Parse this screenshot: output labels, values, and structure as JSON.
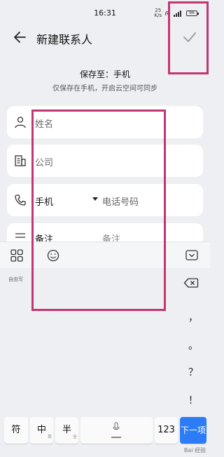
{
  "status": {
    "time": "16:31",
    "net_speed_value": "25",
    "net_speed_unit": "K/s",
    "battery": "96"
  },
  "header": {
    "title": "新建联系人"
  },
  "save_location": {
    "label": "保存至：手机",
    "hint": "仅保存在手机，开启云空间可同步"
  },
  "form": {
    "name_placeholder": "姓名",
    "company_placeholder": "公司",
    "phone_type": "手机",
    "phone_placeholder": "电话号码",
    "notes_label": "备注",
    "notes_placeholder": "备注"
  },
  "keyboard": {
    "freewrite_label": "自由写",
    "punctuation": [
      "，",
      "。",
      "？",
      "！"
    ],
    "keys": {
      "symbol": "符",
      "chinese": "中",
      "chinese_sub": "英",
      "halfwidth": "半",
      "halfwidth_sub": "全",
      "numeric": "123",
      "next": "下一项"
    }
  },
  "watermark": "Bai 经验",
  "colors": {
    "highlight": "#c23672",
    "accent": "#2b7cf6"
  }
}
